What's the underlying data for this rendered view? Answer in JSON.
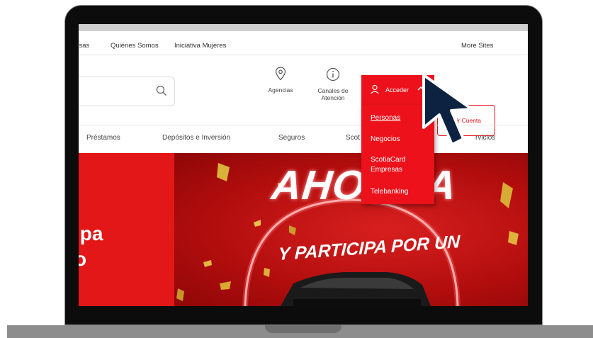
{
  "utility_nav": {
    "items": [
      "resas",
      "Quiénes Somos",
      "Iniciativa Mujeres"
    ],
    "more_sites": "More Sites"
  },
  "header": {
    "agencias": "Agencias",
    "canales_line1": "Canales de",
    "canales_line2": "Atención",
    "acceder": "Acceder",
    "abrir_cuenta": "brir Cuenta"
  },
  "main_nav": {
    "items": [
      "Préstamos",
      "Depósitos e Inversión",
      "Seguros",
      "Scot",
      "rvicios"
    ]
  },
  "dropdown": {
    "personas": "Personas",
    "negocios": "Negocios",
    "scotiacard_line1": "ScotiaCard",
    "scotiacard_line2": "Empresas",
    "telebanking": "Telebanking"
  },
  "hero": {
    "left_line1": "ipa",
    "left_line2": "o",
    "promo_line1": "AHORRA",
    "promo_line2": "Y PARTICIPA POR UN"
  },
  "colors": {
    "brand_red": "#ec111a",
    "cursor": "#0d2140"
  },
  "icons": [
    "search-icon",
    "location-pin-icon",
    "info-icon",
    "person-icon",
    "chevron-up-icon",
    "cursor-arrow-icon"
  ]
}
